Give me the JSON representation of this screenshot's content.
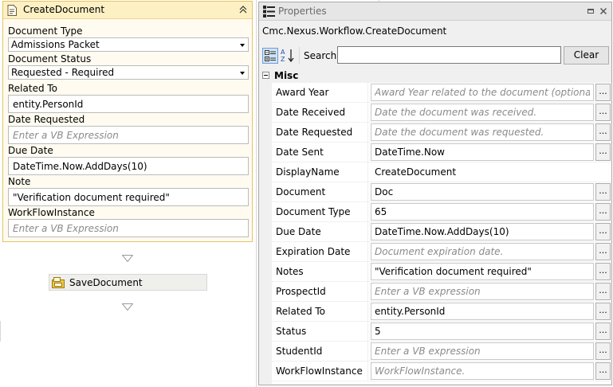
{
  "activity": {
    "title": "CreateDocument",
    "fields": {
      "document_type_label": "Document Type",
      "document_type_value": "Admissions Packet",
      "document_status_label": "Document Status",
      "document_status_value": "Requested - Required",
      "related_to_label": "Related To",
      "related_to_value": "entity.PersonId",
      "date_requested_label": "Date Requested",
      "date_requested_placeholder": "Enter a VB Expression",
      "due_date_label": "Due Date",
      "due_date_value": "DateTime.Now.AddDays(10)",
      "note_label": "Note",
      "note_value": "\"Verification document required\"",
      "workflow_instance_label": "WorkFlowInstance",
      "workflow_instance_placeholder": "Enter a VB Expression"
    }
  },
  "next_activity": {
    "label": "SaveDocument"
  },
  "properties": {
    "title": "Properties",
    "object_name": "Cmc.Nexus.Workflow.CreateDocument",
    "search_label": "Search:",
    "search_value": "",
    "clear_label": "Clear",
    "category": "Misc",
    "ellipsis": "...",
    "rows": [
      {
        "name": "Award Year",
        "value": "Award Year related to the document (optional).",
        "placeholder": true,
        "has_button": true
      },
      {
        "name": "Date Received",
        "value": "Date the document was received.",
        "placeholder": true,
        "has_button": true
      },
      {
        "name": "Date Requested",
        "value": "Date the document was requested.",
        "placeholder": true,
        "has_button": true
      },
      {
        "name": "Date Sent",
        "value": "DateTime.Now",
        "placeholder": false,
        "has_button": true
      },
      {
        "name": "DisplayName",
        "value": "CreateDocument",
        "placeholder": false,
        "has_button": false
      },
      {
        "name": "Document",
        "value": "Doc",
        "placeholder": false,
        "has_button": true
      },
      {
        "name": "Document Type",
        "value": "65",
        "placeholder": false,
        "has_button": true
      },
      {
        "name": "Due Date",
        "value": "DateTime.Now.AddDays(10)",
        "placeholder": false,
        "has_button": true
      },
      {
        "name": "Expiration Date",
        "value": "Document expiration date.",
        "placeholder": true,
        "has_button": true
      },
      {
        "name": "Notes",
        "value": "\"Verification document required\"",
        "placeholder": false,
        "has_button": true
      },
      {
        "name": "ProspectId",
        "value": "Enter a VB expression",
        "placeholder": true,
        "has_button": true
      },
      {
        "name": "Related To",
        "value": "entity.PersonId",
        "placeholder": false,
        "has_button": true
      },
      {
        "name": "Status",
        "value": "5",
        "placeholder": false,
        "has_button": true
      },
      {
        "name": "StudentId",
        "value": "Enter a VB expression",
        "placeholder": true,
        "has_button": true
      },
      {
        "name": "WorkFlowInstance",
        "value": "WorkFlowInstance.",
        "placeholder": true,
        "has_button": true
      }
    ]
  },
  "icons": {
    "activity": "document-icon",
    "collapse": "double-chevron-up-icon",
    "save_activity": "save-activity-icon",
    "properties": "properties-grid-icon",
    "dropdown": "dropdown-arrow-icon",
    "pin": "pin-icon",
    "close": "close-icon",
    "categorized": "categorized-view-icon",
    "alphabetical": "sort-alphabetical-icon"
  }
}
